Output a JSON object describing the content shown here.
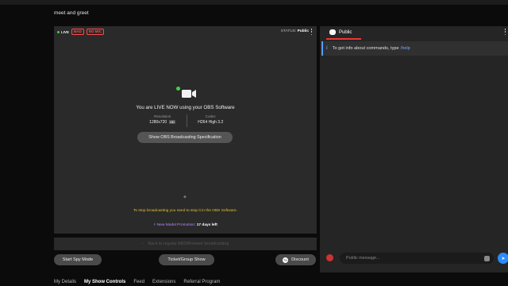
{
  "page": {
    "title": "meet and greet"
  },
  "stream": {
    "live_label": "LIVE",
    "badges": {
      "bad": "BAD",
      "no_mic": "NO MIC"
    },
    "status_label": "STATUS:",
    "status_value": "Public",
    "live_message": "You are LIVE NOW using your OBS Software",
    "resolution_label": "Resolution",
    "resolution_value": "1280x720",
    "resolution_hd": "HD",
    "codec_label": "Codec",
    "codec_value": "H264 High 3.2",
    "spec_button": "Show OBS Broadcasting Specification",
    "stop_note": "To stop broadcasting you need to stop it in the OBS Software.",
    "promo_label": "New Model Promotion:",
    "promo_value": "17 days left"
  },
  "back_bar": {
    "label": "Back to regular ABS/Browser broadcasting"
  },
  "buttons": {
    "spy": "Start Spy Mode",
    "ticket": "Ticket/Group Show",
    "discount": "Discount"
  },
  "tabs": [
    "My Details",
    "My Show Controls",
    "Feed",
    "Extensions",
    "Referral Program"
  ],
  "chat": {
    "tab_label": "Public",
    "notice_text": "To get info about commands, type",
    "notice_cmd": "/help",
    "input_placeholder": "Public message..."
  },
  "colors": {
    "accent_red": "#e33333",
    "live_green": "#3fd14a",
    "send_blue": "#2b8cff"
  },
  "icons": [
    "video-camera-icon",
    "chat-bubble-icon",
    "info-icon",
    "kebab-icon",
    "send-icon",
    "discount-icon",
    "emoji-icon",
    "loader-icon"
  ]
}
